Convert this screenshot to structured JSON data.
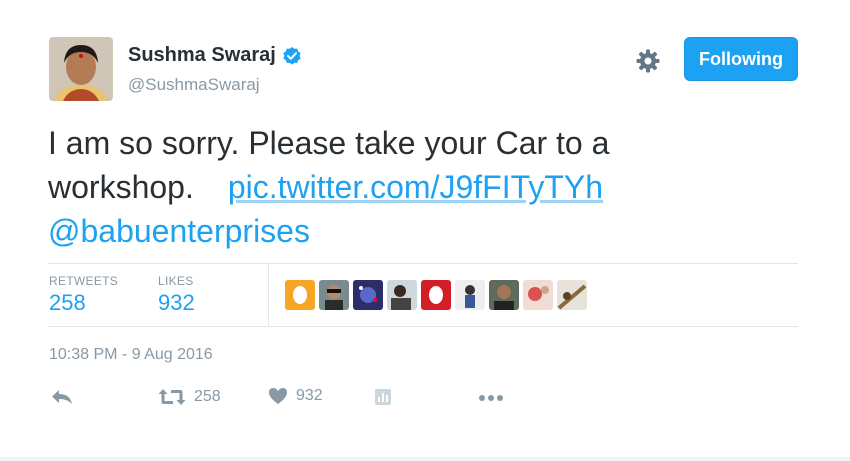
{
  "author": {
    "name": "Sushma Swaraj",
    "handle": "@SushmaSwaraj"
  },
  "follow_button": {
    "label": "Following"
  },
  "tweet": {
    "line1": "I am so sorry. Please take your Car to a",
    "line2_text": "workshop.",
    "link": "pic.twitter.com/J9fFITyTYh",
    "mention": "@babuenterprises"
  },
  "stats": {
    "retweets_label": "RETWEETS",
    "retweets_value": "258",
    "likes_label": "LIKES",
    "likes_value": "932"
  },
  "timestamp": "10:38 PM - 9 Aug 2016",
  "actions": {
    "retweet_count": "258",
    "like_count": "932"
  },
  "colors": {
    "accent": "#1da1f2",
    "muted": "#8899a6",
    "text": "#292f33"
  }
}
